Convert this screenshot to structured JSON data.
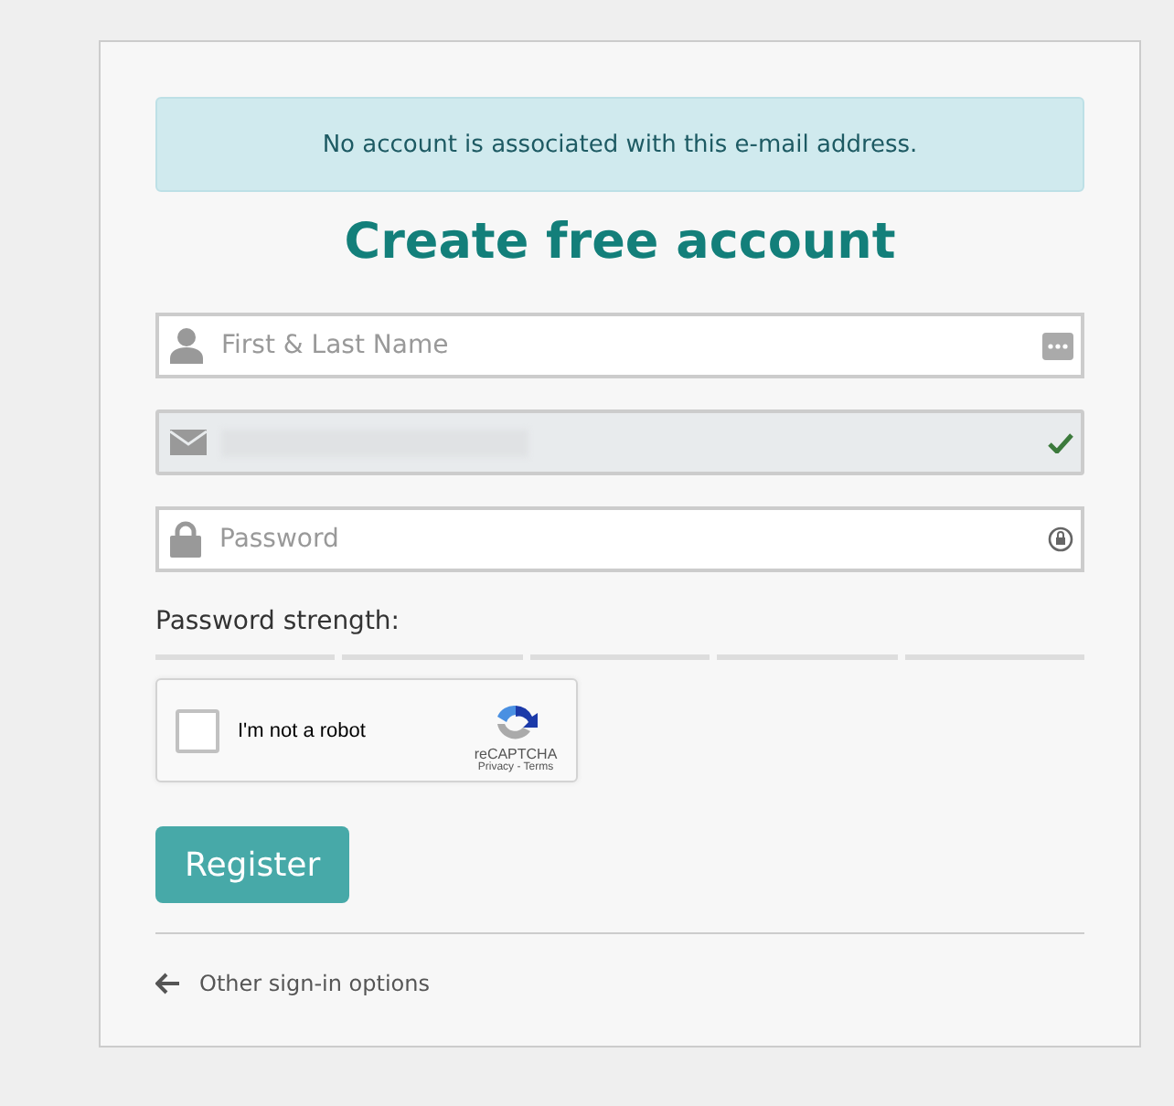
{
  "alert": "No account is associated with this e-mail address.",
  "title": "Create free account",
  "fields": [
    {
      "kind": "name",
      "placeholder": "First & Last Name",
      "valid": false,
      "disabled": false
    },
    {
      "kind": "email",
      "valid": true,
      "disabled": true
    },
    {
      "kind": "password",
      "placeholder": "Password",
      "valid": false,
      "disabled": false
    }
  ],
  "strength": {
    "label": "Password strength:"
  },
  "captcha": {
    "label": "I'm not a robot",
    "checked": false,
    "brand": "reCAPTCHA",
    "links": "Privacy - Terms"
  },
  "register_button": "Register",
  "back_link": "Other sign-in options"
}
